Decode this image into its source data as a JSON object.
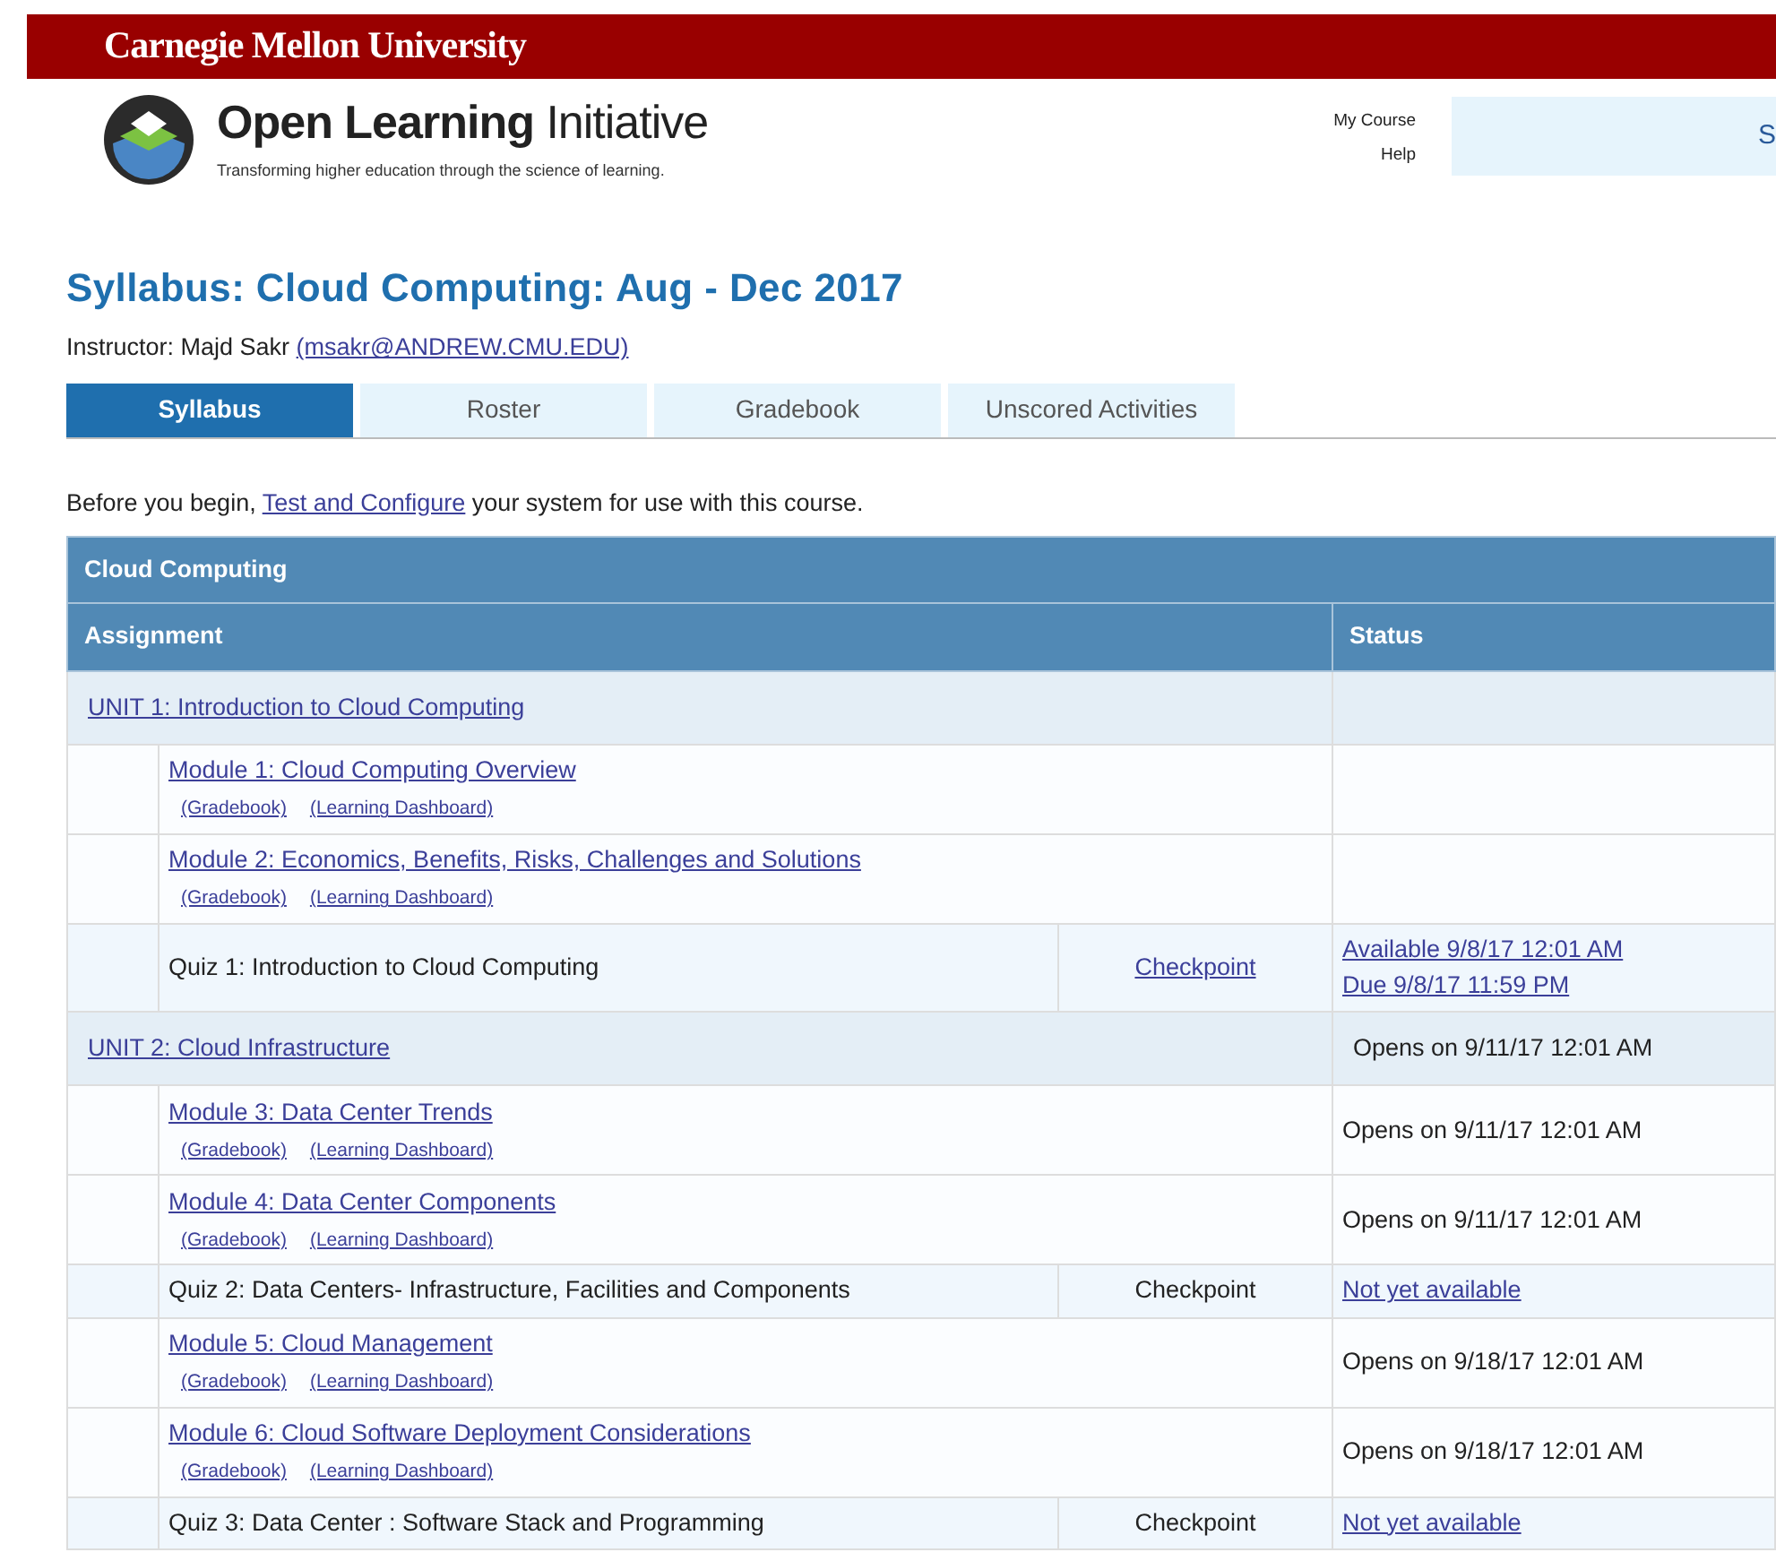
{
  "brand": {
    "university": "Carnegie Mellon University",
    "product_bold": "Open Learning",
    "product_light": "Initiative",
    "tagline": "Transforming higher education through the science of learning."
  },
  "header_links": [
    "My Course",
    "Help"
  ],
  "header_panel": {
    "text": "S"
  },
  "course": {
    "title": "Syllabus: Cloud Computing: Aug - Dec 2017",
    "instructor_label": "Instructor: Majd Sakr",
    "instructor_email": "(msakr@ANDREW.CMU.EDU)"
  },
  "tabs": [
    {
      "label": "Syllabus",
      "selected": true
    },
    {
      "label": "Roster",
      "selected": false
    },
    {
      "label": "Gradebook",
      "selected": false
    },
    {
      "label": "Unscored Activities",
      "selected": false
    }
  ],
  "intro": {
    "before": "Before you begin,",
    "link": "Test and Configure",
    "after": "your system for use with this course."
  },
  "table": {
    "caption": "Cloud Computing",
    "columns": [
      "Assignment",
      "Status"
    ],
    "rows": [
      {
        "kind": "unit",
        "title": "UNIT 1: Introduction to Cloud Computing",
        "status": []
      },
      {
        "kind": "module",
        "title": "Module 1: Cloud Computing Overview",
        "links": [
          "(Gradebook)",
          "(Learning Dashboard)"
        ],
        "status": []
      },
      {
        "kind": "module",
        "title": "Module 2: Economics, Benefits, Risks, Challenges and Solutions",
        "links": [
          "(Gradebook)",
          "(Learning Dashboard)"
        ],
        "status": []
      },
      {
        "kind": "quiz",
        "title": "Quiz 1: Introduction to Cloud Computing",
        "checkpoint": {
          "text": "Checkpoint",
          "link": true
        },
        "status": [
          {
            "text": "Available 9/8/17 12:01 AM",
            "link": true
          },
          {
            "text": "Due 9/8/17 11:59 PM",
            "link": true
          }
        ]
      },
      {
        "kind": "unit",
        "title": "UNIT 2: Cloud Infrastructure",
        "status": [
          {
            "text": "Opens on 9/11/17 12:01 AM",
            "link": false
          }
        ]
      },
      {
        "kind": "module",
        "title": "Module 3: Data Center Trends",
        "links": [
          "(Gradebook)",
          "(Learning Dashboard)"
        ],
        "status": [
          {
            "text": "Opens on 9/11/17 12:01 AM",
            "link": false
          }
        ]
      },
      {
        "kind": "module",
        "title": "Module 4: Data Center Components",
        "links": [
          "(Gradebook)",
          "(Learning Dashboard)"
        ],
        "status": [
          {
            "text": "Opens on 9/11/17 12:01 AM",
            "link": false
          }
        ]
      },
      {
        "kind": "quiz",
        "title": "Quiz 2: Data Centers- Infrastructure, Facilities and Components",
        "checkpoint": {
          "text": "Checkpoint",
          "link": false
        },
        "status": [
          {
            "text": "Not yet available",
            "link": true
          }
        ]
      },
      {
        "kind": "module",
        "title": "Module 5: Cloud Management",
        "links": [
          "(Gradebook)",
          "(Learning Dashboard)"
        ],
        "status": [
          {
            "text": "Opens on 9/18/17 12:01 AM",
            "link": false
          }
        ]
      },
      {
        "kind": "module",
        "title": "Module 6: Cloud Software Deployment Considerations",
        "links": [
          "(Gradebook)",
          "(Learning Dashboard)"
        ],
        "status": [
          {
            "text": "Opens on 9/18/17 12:01 AM",
            "link": false
          }
        ]
      },
      {
        "kind": "quiz",
        "title": "Quiz 3: Data Center : Software Stack and Programming",
        "checkpoint": {
          "text": "Checkpoint",
          "link": false
        },
        "status": [
          {
            "text": "Not yet available",
            "link": true
          }
        ]
      }
    ]
  }
}
